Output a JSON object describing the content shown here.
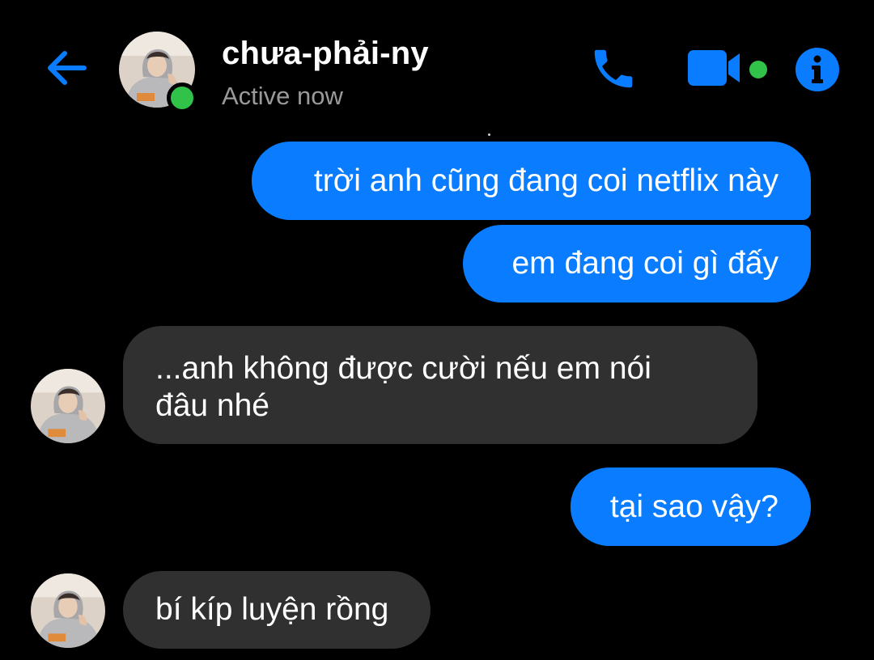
{
  "header": {
    "contact_name": "chưa-phải-ny",
    "status": "Active now",
    "icons": {
      "back": "arrow-left-icon",
      "call": "phone-icon",
      "video": "video-camera-icon",
      "info": "info-icon"
    },
    "accent_color": "#0a7cff",
    "presence_color": "#31c24a"
  },
  "messages": [
    {
      "direction": "outgoing",
      "text": "trời anh cũng đang coi netflix này"
    },
    {
      "direction": "outgoing",
      "text": "em đang coi gì đấy"
    },
    {
      "direction": "incoming",
      "lines": [
        "...anh không được cười nếu em nói",
        "đâu nhé"
      ]
    },
    {
      "direction": "outgoing",
      "text": "tại sao vậy?"
    },
    {
      "direction": "incoming",
      "text": "bí kíp luyện rồng"
    }
  ],
  "colors": {
    "outgoing_bubble": "#0a7cff",
    "incoming_bubble": "#303030",
    "background": "#000000"
  }
}
